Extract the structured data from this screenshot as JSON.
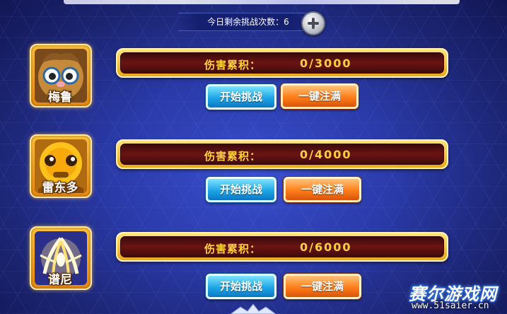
{
  "header": {
    "remaining_label": "今日剩余挑战次数：6",
    "add_icon": "plus-icon"
  },
  "bosses": [
    {
      "name": "梅鲁",
      "damage_label": "伤害累积：",
      "damage_value": "0/3000",
      "start_label": "开始挑战",
      "fill_label": "一键注满"
    },
    {
      "name": "雷东多",
      "damage_label": "伤害累积：",
      "damage_value": "0/4000",
      "start_label": "开始挑战",
      "fill_label": "一键注满"
    },
    {
      "name": "谱尼",
      "damage_label": "伤害累积：",
      "damage_value": "0/6000",
      "start_label": "开始挑战",
      "fill_label": "一键注满"
    }
  ],
  "watermark": {
    "title": "赛尔游戏网",
    "url": "www.51saier.cn"
  },
  "colors": {
    "background": "#2a3aa8",
    "gold_text": "#ffd23a",
    "start_button": "#1ea6e6",
    "fill_button": "#ff7e1a"
  }
}
